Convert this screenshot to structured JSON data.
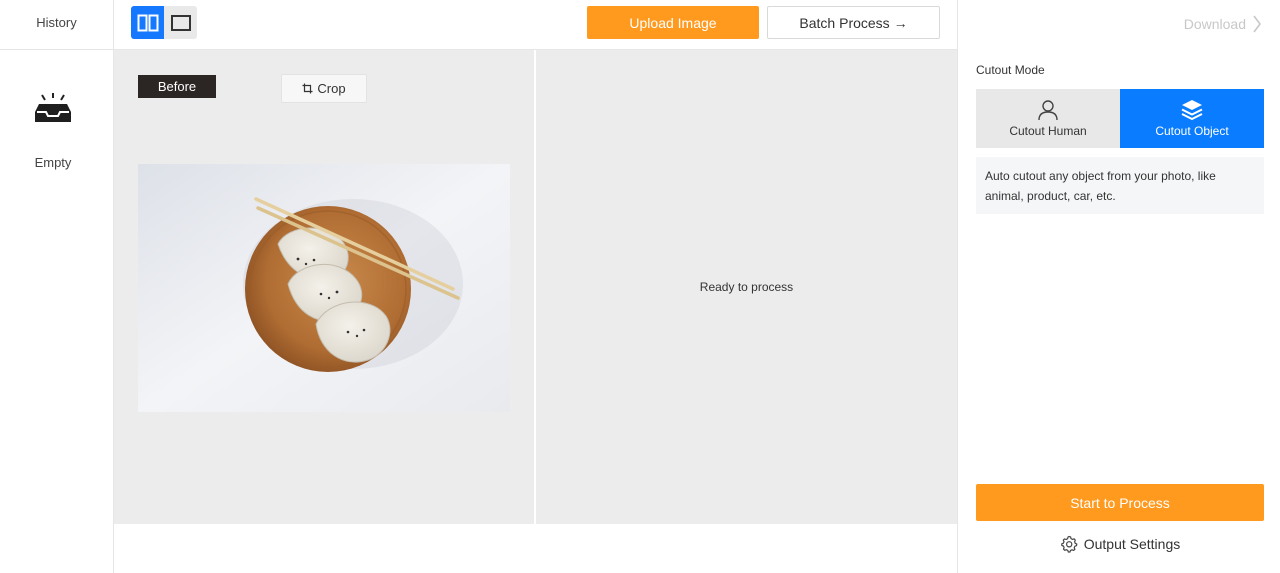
{
  "history": {
    "title": "History",
    "empty_icon": "empty-inbox-icon",
    "empty_text": "Empty"
  },
  "toolbar": {
    "view_modes": [
      {
        "name": "split-view-icon",
        "active": true
      },
      {
        "name": "single-view-icon",
        "active": false
      }
    ],
    "upload_label": "Upload Image",
    "batch_label": "Batch Process →"
  },
  "canvas": {
    "before_badge": "Before",
    "crop_label": "Crop",
    "crop_icon": "crop-icon",
    "ready_text": "Ready to process"
  },
  "panel": {
    "download_label": "Download",
    "download_icon": "chevron-right-icon",
    "mode_label": "Cutout Mode",
    "modes": [
      {
        "label": "Cutout Human",
        "icon": "person-icon",
        "selected": false
      },
      {
        "label": "Cutout Object",
        "icon": "layers-icon",
        "selected": true
      }
    ],
    "description": "Auto cutout any object from your photo, like animal, product, car, etc.",
    "start_label": "Start to Process",
    "output_settings_label": "Output Settings",
    "output_settings_icon": "gear-icon"
  },
  "colors": {
    "accent_orange": "#ff9a1e",
    "accent_blue": "#0a7cff",
    "canvas_bg": "#ececec"
  }
}
